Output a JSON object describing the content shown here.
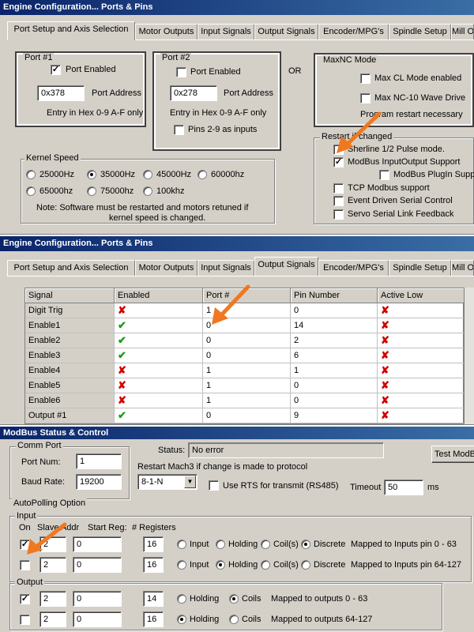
{
  "panel1": {
    "title": "Engine Configuration... Ports & Pins",
    "tabs": [
      "Port Setup and Axis Selection",
      "Motor Outputs",
      "Input Signals",
      "Output Signals",
      "Encoder/MPG's",
      "Spindle Setup",
      "Mill O"
    ],
    "port1": {
      "label": "Port #1",
      "enabled_label": "Port Enabled",
      "address": "0x378",
      "address_label": "Port Address",
      "hint": "Entry in Hex 0-9 A-F only"
    },
    "port2": {
      "label": "Port #2",
      "enabled_label": "Port Enabled",
      "address": "0x278",
      "address_label": "Port Address",
      "hint": "Entry in Hex 0-9 A-F only",
      "pins_label": "Pins 2-9 as inputs"
    },
    "or_label": "OR",
    "maxnc": {
      "label": "MaxNC Mode",
      "cl_label": "Max CL Mode enabled",
      "nc10_label": "Max NC-10 Wave Drive",
      "restart_note": "Program restart necessary"
    },
    "restart": {
      "label": "Restart if changed",
      "items": [
        "Sherline 1/2 Pulse mode.",
        "ModBus InputOutput Support",
        "ModBus PlugIn Supp",
        "TCP Modbus support",
        "Event Driven Serial Control",
        "Servo Serial Link Feedback"
      ]
    },
    "kernel": {
      "label": "Kernel Speed",
      "speeds": [
        "25000Hz",
        "35000Hz",
        "45000Hz",
        "60000hz",
        "65000hz",
        "75000hz",
        "100khz"
      ],
      "selected": "35000Hz",
      "note1": "Note: Software must be restarted and motors retuned if",
      "note2": "kernel speed is changed."
    }
  },
  "panel2": {
    "title": "Engine Configuration... Ports & Pins",
    "tabs": [
      "Port Setup and Axis Selection",
      "Motor Outputs",
      "Input Signals",
      "Output Signals",
      "Encoder/MPG's",
      "Spindle Setup",
      "Mill O"
    ],
    "columns": [
      "Signal",
      "Enabled",
      "Port #",
      "Pin Number",
      "Active Low"
    ],
    "rows": [
      {
        "signal": "Digit  Trig",
        "enabled": false,
        "port": "1",
        "pin": "0",
        "active_low": false
      },
      {
        "signal": "Enable1",
        "enabled": true,
        "port": "0",
        "pin": "14",
        "active_low": false
      },
      {
        "signal": "Enable2",
        "enabled": true,
        "port": "0",
        "pin": "2",
        "active_low": false
      },
      {
        "signal": "Enable3",
        "enabled": true,
        "port": "0",
        "pin": "6",
        "active_low": false
      },
      {
        "signal": "Enable4",
        "enabled": false,
        "port": "1",
        "pin": "1",
        "active_low": false
      },
      {
        "signal": "Enable5",
        "enabled": false,
        "port": "1",
        "pin": "0",
        "active_low": false
      },
      {
        "signal": "Enable6",
        "enabled": false,
        "port": "1",
        "pin": "0",
        "active_low": false
      },
      {
        "signal": "Output #1",
        "enabled": true,
        "port": "0",
        "pin": "9",
        "active_low": false
      }
    ]
  },
  "panel3": {
    "title": "ModBus Status & Control",
    "comm": {
      "label": "Comm Port",
      "port_label": "Port Num:",
      "port_value": "1",
      "baud_label": "Baud Rate:",
      "baud_value": "19200"
    },
    "status_label": "Status:",
    "status_value": "No error",
    "test_button": "Test ModB",
    "restart_note": "Restart Mach3 if change is made to protocol",
    "protocol": "8-1-N",
    "rts_label": "Use RTS for transmit (RS485)",
    "timeout_label": "Timeout",
    "timeout_value": "50",
    "timeout_unit": "ms",
    "autopoll_label": "AutoPolling Option",
    "input": {
      "label": "Input",
      "headers": {
        "on": "On",
        "slave": "Slave Addr",
        "start": "Start Reg:",
        "regs": "# Registers"
      },
      "rows": [
        {
          "on": true,
          "slave": "2",
          "start": "0",
          "regs": "16",
          "options": [
            "Input",
            "Holding",
            "Coil(s)",
            "Discrete"
          ],
          "selected": "Discrete",
          "mapped": "Mapped to Inputs pin 0 - 63"
        },
        {
          "on": false,
          "slave": "2",
          "start": "0",
          "regs": "16",
          "options": [
            "Input",
            "Holding",
            "Coil(s)",
            "Discrete"
          ],
          "selected": "Holding",
          "mapped": "Mapped to Inputs pin 64-127"
        }
      ]
    },
    "output": {
      "label": "Output",
      "rows": [
        {
          "on": true,
          "slave": "2",
          "start": "0",
          "regs": "14",
          "options": [
            "Holding",
            "Coils"
          ],
          "selected": "Coils",
          "mapped": "Mapped to outputs 0 - 63"
        },
        {
          "on": false,
          "slave": "2",
          "start": "0",
          "regs": "16",
          "options": [
            "Holding",
            "Coils"
          ],
          "selected": "Holding",
          "mapped": "Mapped to outputs 64-127"
        }
      ]
    }
  },
  "colors": {
    "title_bar": "#0a246a",
    "arrow": "#f07820",
    "cross": "#d00000",
    "check": "#1a9c1a"
  }
}
